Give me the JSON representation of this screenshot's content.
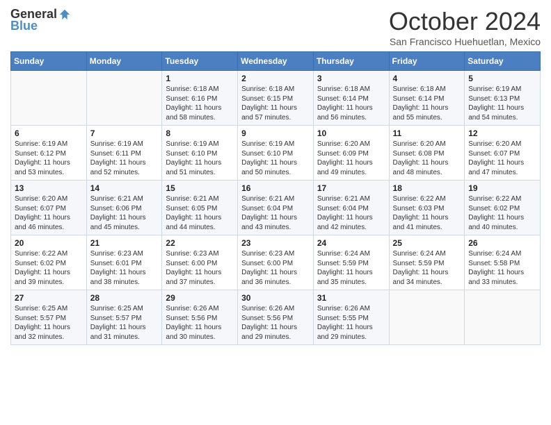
{
  "header": {
    "logo_general": "General",
    "logo_blue": "Blue",
    "month_title": "October 2024",
    "subtitle": "San Francisco Huehuetlan, Mexico"
  },
  "days_of_week": [
    "Sunday",
    "Monday",
    "Tuesday",
    "Wednesday",
    "Thursday",
    "Friday",
    "Saturday"
  ],
  "weeks": [
    [
      {
        "day": "",
        "info": ""
      },
      {
        "day": "",
        "info": ""
      },
      {
        "day": "1",
        "info": "Sunrise: 6:18 AM\nSunset: 6:16 PM\nDaylight: 11 hours and 58 minutes."
      },
      {
        "day": "2",
        "info": "Sunrise: 6:18 AM\nSunset: 6:15 PM\nDaylight: 11 hours and 57 minutes."
      },
      {
        "day": "3",
        "info": "Sunrise: 6:18 AM\nSunset: 6:14 PM\nDaylight: 11 hours and 56 minutes."
      },
      {
        "day": "4",
        "info": "Sunrise: 6:18 AM\nSunset: 6:14 PM\nDaylight: 11 hours and 55 minutes."
      },
      {
        "day": "5",
        "info": "Sunrise: 6:19 AM\nSunset: 6:13 PM\nDaylight: 11 hours and 54 minutes."
      }
    ],
    [
      {
        "day": "6",
        "info": "Sunrise: 6:19 AM\nSunset: 6:12 PM\nDaylight: 11 hours and 53 minutes."
      },
      {
        "day": "7",
        "info": "Sunrise: 6:19 AM\nSunset: 6:11 PM\nDaylight: 11 hours and 52 minutes."
      },
      {
        "day": "8",
        "info": "Sunrise: 6:19 AM\nSunset: 6:10 PM\nDaylight: 11 hours and 51 minutes."
      },
      {
        "day": "9",
        "info": "Sunrise: 6:19 AM\nSunset: 6:10 PM\nDaylight: 11 hours and 50 minutes."
      },
      {
        "day": "10",
        "info": "Sunrise: 6:20 AM\nSunset: 6:09 PM\nDaylight: 11 hours and 49 minutes."
      },
      {
        "day": "11",
        "info": "Sunrise: 6:20 AM\nSunset: 6:08 PM\nDaylight: 11 hours and 48 minutes."
      },
      {
        "day": "12",
        "info": "Sunrise: 6:20 AM\nSunset: 6:07 PM\nDaylight: 11 hours and 47 minutes."
      }
    ],
    [
      {
        "day": "13",
        "info": "Sunrise: 6:20 AM\nSunset: 6:07 PM\nDaylight: 11 hours and 46 minutes."
      },
      {
        "day": "14",
        "info": "Sunrise: 6:21 AM\nSunset: 6:06 PM\nDaylight: 11 hours and 45 minutes."
      },
      {
        "day": "15",
        "info": "Sunrise: 6:21 AM\nSunset: 6:05 PM\nDaylight: 11 hours and 44 minutes."
      },
      {
        "day": "16",
        "info": "Sunrise: 6:21 AM\nSunset: 6:04 PM\nDaylight: 11 hours and 43 minutes."
      },
      {
        "day": "17",
        "info": "Sunrise: 6:21 AM\nSunset: 6:04 PM\nDaylight: 11 hours and 42 minutes."
      },
      {
        "day": "18",
        "info": "Sunrise: 6:22 AM\nSunset: 6:03 PM\nDaylight: 11 hours and 41 minutes."
      },
      {
        "day": "19",
        "info": "Sunrise: 6:22 AM\nSunset: 6:02 PM\nDaylight: 11 hours and 40 minutes."
      }
    ],
    [
      {
        "day": "20",
        "info": "Sunrise: 6:22 AM\nSunset: 6:02 PM\nDaylight: 11 hours and 39 minutes."
      },
      {
        "day": "21",
        "info": "Sunrise: 6:23 AM\nSunset: 6:01 PM\nDaylight: 11 hours and 38 minutes."
      },
      {
        "day": "22",
        "info": "Sunrise: 6:23 AM\nSunset: 6:00 PM\nDaylight: 11 hours and 37 minutes."
      },
      {
        "day": "23",
        "info": "Sunrise: 6:23 AM\nSunset: 6:00 PM\nDaylight: 11 hours and 36 minutes."
      },
      {
        "day": "24",
        "info": "Sunrise: 6:24 AM\nSunset: 5:59 PM\nDaylight: 11 hours and 35 minutes."
      },
      {
        "day": "25",
        "info": "Sunrise: 6:24 AM\nSunset: 5:59 PM\nDaylight: 11 hours and 34 minutes."
      },
      {
        "day": "26",
        "info": "Sunrise: 6:24 AM\nSunset: 5:58 PM\nDaylight: 11 hours and 33 minutes."
      }
    ],
    [
      {
        "day": "27",
        "info": "Sunrise: 6:25 AM\nSunset: 5:57 PM\nDaylight: 11 hours and 32 minutes."
      },
      {
        "day": "28",
        "info": "Sunrise: 6:25 AM\nSunset: 5:57 PM\nDaylight: 11 hours and 31 minutes."
      },
      {
        "day": "29",
        "info": "Sunrise: 6:26 AM\nSunset: 5:56 PM\nDaylight: 11 hours and 30 minutes."
      },
      {
        "day": "30",
        "info": "Sunrise: 6:26 AM\nSunset: 5:56 PM\nDaylight: 11 hours and 29 minutes."
      },
      {
        "day": "31",
        "info": "Sunrise: 6:26 AM\nSunset: 5:55 PM\nDaylight: 11 hours and 29 minutes."
      },
      {
        "day": "",
        "info": ""
      },
      {
        "day": "",
        "info": ""
      }
    ]
  ]
}
